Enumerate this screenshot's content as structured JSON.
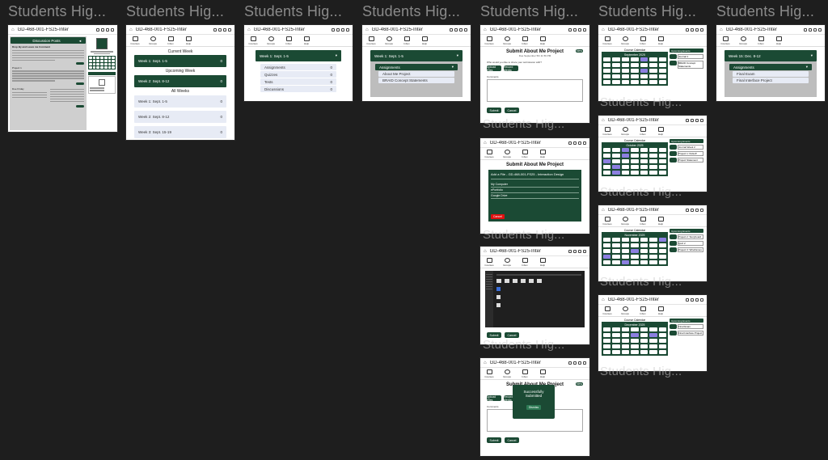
{
  "frame_title": "Students Hig...",
  "course_title": "GD-468-001-FS25-Inter",
  "nav": [
    "Courses",
    "Groups",
    "Inbox",
    "Help"
  ],
  "discussion": {
    "title": "Discussion Posts",
    "post1": "Drop By and Leave me Comment",
    "post2": "Project 1",
    "post3": "Due Friday",
    "post_label": "Post Here"
  },
  "weeks": {
    "current_label": "Current Week",
    "upcoming_label": "Upcoming Week",
    "all_label": "All Weeks",
    "current": "Week 1: Sept. 1-5",
    "upcoming": "Week 2: Sept. 8-12",
    "all": [
      "Week 1: Sept. 1-5",
      "Week 2: Sept. 8-12",
      "Week 3: Sept. 15-19"
    ],
    "count": "0"
  },
  "week_detail": {
    "header": "Week 1: Sept. 1-5",
    "items": [
      "Assignments",
      "Quizzes",
      "Tests",
      "Discussions"
    ],
    "count": "0"
  },
  "assign_dropdown": {
    "header": "Week 1: Sept. 1-5",
    "label": "Assignments",
    "items": [
      "About Me Project",
      "BRAID Concept Statements"
    ]
  },
  "submit": {
    "title": "Submit About Me Project",
    "badge": "New",
    "due_text": "Due September 5th 11:59 PM",
    "choose_text": "Who would you like to share your submission with?",
    "upload_btn": "Upload Files",
    "record_btn": "Record Media",
    "comments_label": "Comments",
    "submit_btn": "Submit",
    "cancel_btn": "Cancel"
  },
  "add_file": {
    "title": "Submit About Me Project",
    "header": "Add a File - GD-468-001-FS25 - Interaction Design",
    "options": [
      "My Computer",
      "ePortfolio",
      "Google Drive"
    ],
    "cancel": "Cancel"
  },
  "success": {
    "line1": "Successfully",
    "line2": "Submitted",
    "dismiss": "Dismiss"
  },
  "calendar": {
    "title": "Course Calendar",
    "months": [
      "September 2025",
      "October 2025",
      "November 2025",
      "December 2025"
    ],
    "upcoming_label": "Upcoming Events",
    "sep_events": [
      "Journal 1",
      "BRAID Concept Statements"
    ],
    "oct_events": [
      "Journal Week 2",
      "Project 1: Kickoff",
      "Project Statement"
    ],
    "nov_events": [
      "Project 2: Storyboard",
      "Quiz 2",
      "Project 3: Wireframes"
    ],
    "dec_events": [
      "Final Exam",
      "Final Interface Project"
    ]
  },
  "week_dec": {
    "header": "Week 15: Dec. 8-12",
    "label": "Assignments",
    "items": [
      "Final Exam",
      "Final Interface Project"
    ]
  },
  "ghost_label": "Students Hig..."
}
